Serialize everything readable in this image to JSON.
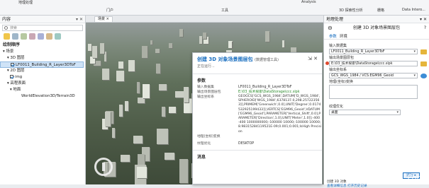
{
  "ribbon": {
    "groups": [
      "地理处理",
      "门户",
      "工具",
      "Analysis",
      "3D 探索性分析",
      "栅格",
      "Data Intero..."
    ]
  },
  "contents": {
    "title": "内容",
    "search_placeholder": "搜索",
    "draw_order": "绘制顺序",
    "scene": "场景",
    "layer_3d": "3D 图层",
    "building_layer": "LF0011_Building_R_Layer3DToF",
    "layer_2d": "2D 图层",
    "img": "img",
    "elev_surface": "高程表面",
    "ground": "地面",
    "world_elev": "WorldElevation3D/Terrain3D"
  },
  "map": {
    "tab": "场景"
  },
  "popup": {
    "title": "创建 3D 对象场景图层包",
    "title_sub": "(数据管理工具)",
    "status": "正在运行...",
    "section_params": "参数",
    "params": [
      {
        "k": "输入数据集",
        "v": "LF0011_Building_R_Layer3DToF",
        "green": false
      },
      {
        "k": "输出场景图层包",
        "v": "E:\\03_技术探索\\DataStorage\\ccc.slpk",
        "green": true
      },
      {
        "k": "输出坐标系",
        "v": "GEOGCS['GCS_WGS_1984',DATUM['D_WGS_1984',SPHEROID['WGS_1984',6378137.0,298.257223563]],PRIMEM['Greenwich',0.0],UNIT['Degree',0.0174532925199433]],VERTCS['EGM96_Geoid',VDATUM['EGM96_Geoid'],PARAMETER['Vertical_Shift',0.0],PARAMETER['Direction',1.0],UNIT['Meter',1.0]];-400 -400 1000000000;-100000 10000;-100000 10000;8.98315284119521E-09;0.001;0.001;IsHigh Precision",
        "green": false
      },
      {
        "k": "地理(坐标)变换",
        "v": "",
        "green": false
      },
      {
        "k": "纹理优化",
        "v": "DESKTOP",
        "green": false
      }
    ],
    "section_messages": "消息"
  },
  "geoprocessing": {
    "pane_title": "地理处理",
    "tool_title": "创建 3D 对象场景图层包",
    "tab_params": "参数",
    "tab_env": "环境",
    "input_label": "输入数据集",
    "input_value": "LF0011_Building_R_Layer3DToF",
    "output_label": "输出场景图层包",
    "output_value": "E:\\03_技术探索\\DataStorage\\ccc.slpk",
    "coord_label": "输出坐标系",
    "coord_value": "GCS_WGS_1984 / VCS:EGM96_Geoid",
    "transform_label": "地理(坐标)变换",
    "texture_label": "纹理优化",
    "texture_value": "桌面",
    "run_button": "运行",
    "footer_link": "查看详细信息  打开历史记录",
    "status_prefix": "创建 3D 对象"
  },
  "watermark": "CSDN @GB_Fore"
}
